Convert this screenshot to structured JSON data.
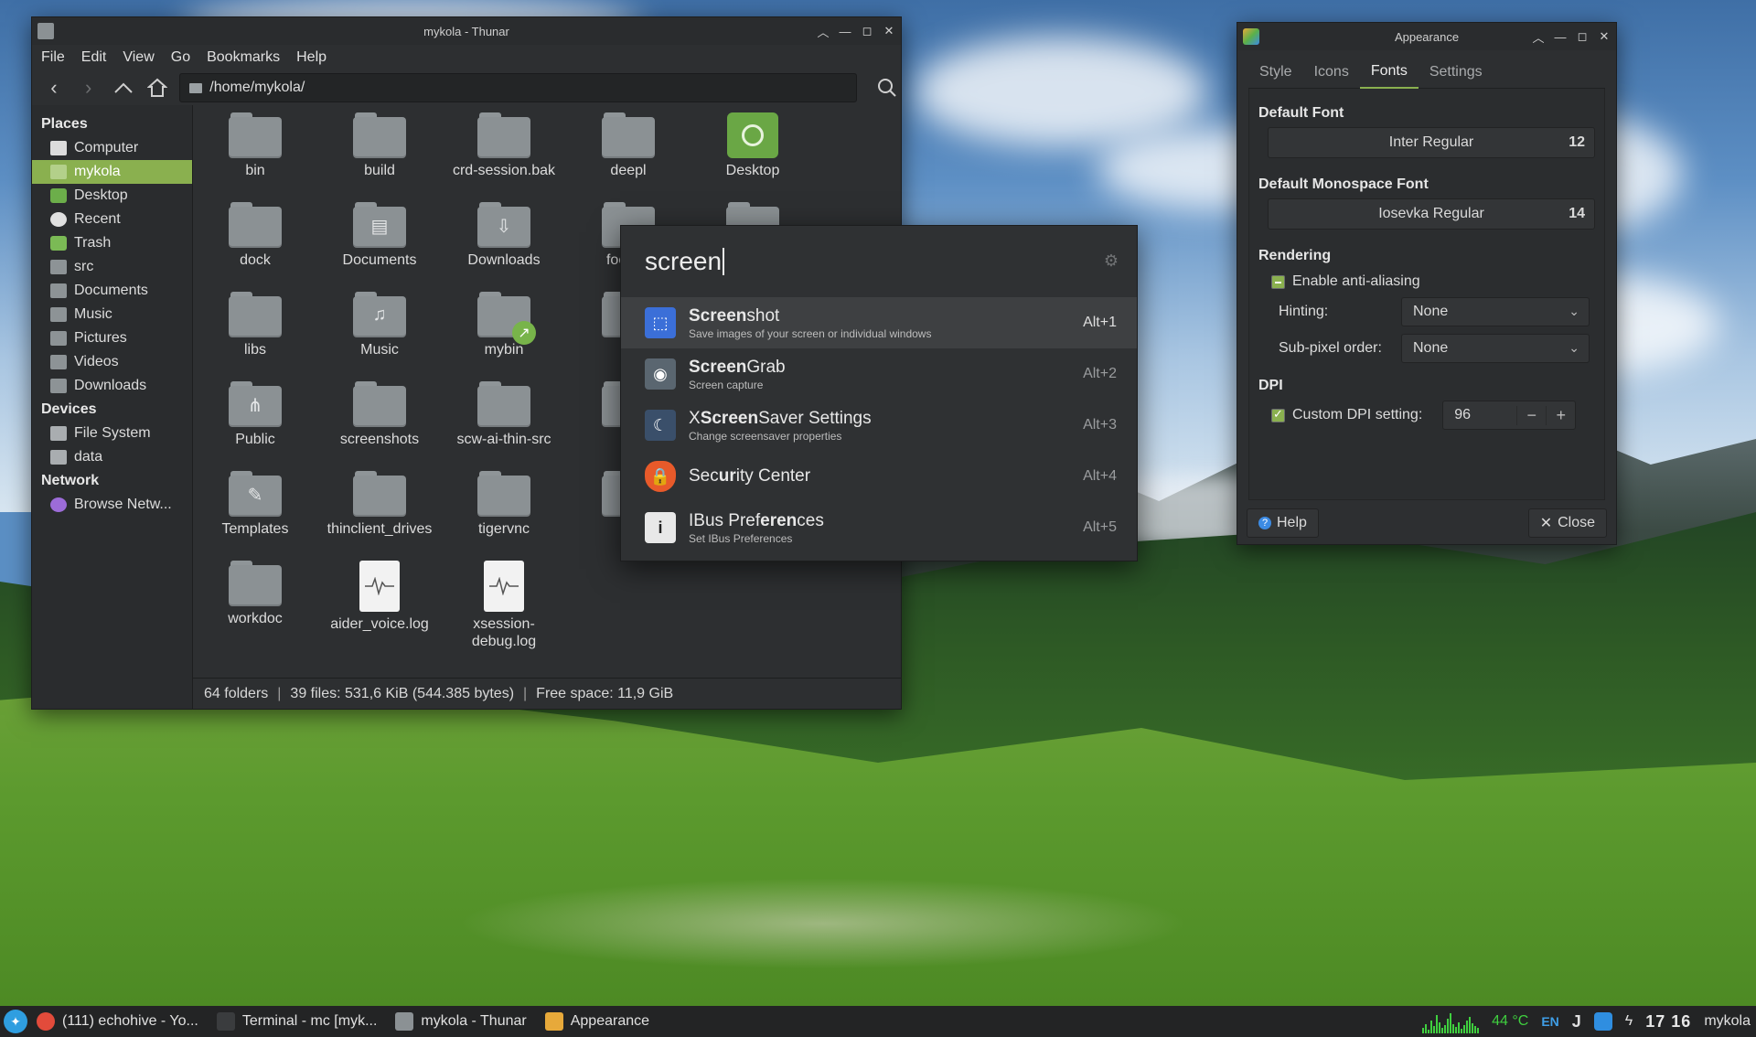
{
  "thunar": {
    "title": "mykola - Thunar",
    "menu": [
      "File",
      "Edit",
      "View",
      "Go",
      "Bookmarks",
      "Help"
    ],
    "location": "/home/mykola/",
    "sidebar": {
      "places_label": "Places",
      "places": [
        "Computer",
        "mykola",
        "Desktop",
        "Recent",
        "Trash",
        "src",
        "Documents",
        "Music",
        "Pictures",
        "Videos",
        "Downloads"
      ],
      "devices_label": "Devices",
      "devices": [
        "File System",
        "data"
      ],
      "network_label": "Network",
      "network": [
        "Browse Netw..."
      ]
    },
    "files": [
      {
        "name": "bin",
        "icon": "folder"
      },
      {
        "name": "build",
        "icon": "folder"
      },
      {
        "name": "crd-session.bak",
        "icon": "folder"
      },
      {
        "name": "deepl",
        "icon": "folder"
      },
      {
        "name": "Desktop",
        "icon": "desktop"
      },
      {
        "name": "",
        "icon": "none"
      },
      {
        "name": "dock",
        "icon": "folder"
      },
      {
        "name": "Documents",
        "icon": "folder-documents"
      },
      {
        "name": "Downloads",
        "icon": "folder-downloads"
      },
      {
        "name": "fooocu",
        "icon": "folder"
      },
      {
        "name": "",
        "icon": "folder"
      },
      {
        "name": "",
        "icon": "none"
      },
      {
        "name": "libs",
        "icon": "folder"
      },
      {
        "name": "Music",
        "icon": "folder-music"
      },
      {
        "name": "mybin",
        "icon": "folder-link"
      },
      {
        "name": "pd",
        "icon": "folder"
      },
      {
        "name": "",
        "icon": "none"
      },
      {
        "name": "",
        "icon": "none"
      },
      {
        "name": "Public",
        "icon": "folder-public"
      },
      {
        "name": "screenshots",
        "icon": "folder"
      },
      {
        "name": "scw-ai-thin-src",
        "icon": "folder"
      },
      {
        "name": "s",
        "icon": "folder"
      },
      {
        "name": "",
        "icon": "none"
      },
      {
        "name": "",
        "icon": "none"
      },
      {
        "name": "Templates",
        "icon": "folder-templates"
      },
      {
        "name": "thinclient_drives",
        "icon": "folder"
      },
      {
        "name": "tigervnc",
        "icon": "folder"
      },
      {
        "name": "Vi",
        "icon": "folder"
      },
      {
        "name": "",
        "icon": "none"
      },
      {
        "name": "",
        "icon": "none"
      },
      {
        "name": "workdoc",
        "icon": "folder"
      },
      {
        "name": "aider_voice.log",
        "icon": "log-file"
      },
      {
        "name": "xsession-debug.log",
        "icon": "log-file"
      }
    ],
    "status": {
      "folders": "64 folders",
      "files": "39 files: 531,6 KiB (544.385 bytes)",
      "free": "Free space: 11,9 GiB"
    }
  },
  "launcher": {
    "query": "screen",
    "results": [
      {
        "pre": "",
        "match": "Screen",
        "post": "shot",
        "subtitle": "Save images of your screen or individual windows",
        "shortcut": "Alt+1",
        "icon": "screenshot-icon",
        "color": "#3b6fd8"
      },
      {
        "pre": "",
        "match": "Screen",
        "post": "Grab",
        "subtitle": "Screen capture",
        "shortcut": "Alt+2",
        "icon": "camera-icon",
        "color": "#5a6670"
      },
      {
        "pre": "X",
        "match": "Screen",
        "post": "Saver Settings",
        "subtitle": "Change screensaver properties",
        "shortcut": "Alt+3",
        "icon": "monitor-icon",
        "color": "#3a4f6a"
      },
      {
        "pre": "Sec",
        "match": "ur",
        "post": "ity Center",
        "subtitle": "",
        "shortcut": "Alt+4",
        "icon": "shield-icon",
        "color": "#e85a2a"
      },
      {
        "pre": "IBus Pref",
        "match": "eren",
        "post": "ces",
        "subtitle": "Set IBus Preferences",
        "shortcut": "Alt+5",
        "icon": "info-icon",
        "color": "#e8e8e8"
      }
    ]
  },
  "appearance": {
    "title": "Appearance",
    "tabs": [
      "Style",
      "Icons",
      "Fonts",
      "Settings"
    ],
    "active_tab": "Fonts",
    "default_font_label": "Default Font",
    "default_font": "Inter Regular",
    "default_font_size": "12",
    "mono_font_label": "Default Monospace Font",
    "mono_font": "Iosevka Regular",
    "mono_font_size": "14",
    "rendering_label": "Rendering",
    "antialias_label": "Enable anti-aliasing",
    "hinting_label": "Hinting:",
    "hinting_value": "None",
    "subpixel_label": "Sub-pixel order:",
    "subpixel_value": "None",
    "dpi_label": "DPI",
    "custom_dpi_label": "Custom DPI setting:",
    "dpi_value": "96",
    "help_label": "Help",
    "close_label": "Close"
  },
  "taskbar": {
    "tasks": [
      {
        "label": "(111) echohive - Yo...",
        "icon": "chrome-icon",
        "color": "#e24b3b"
      },
      {
        "label": "Terminal - mc [myk...",
        "icon": "terminal-icon",
        "color": "#3a3c3e"
      },
      {
        "label": "mykola - Thunar",
        "icon": "folder-icon",
        "color": "#8b9194"
      },
      {
        "label": "Appearance",
        "icon": "appearance-icon",
        "color": "#e7a93a"
      }
    ],
    "temperature": "44 °C",
    "language": "EN",
    "clock": "17 16",
    "user": "mykola"
  }
}
